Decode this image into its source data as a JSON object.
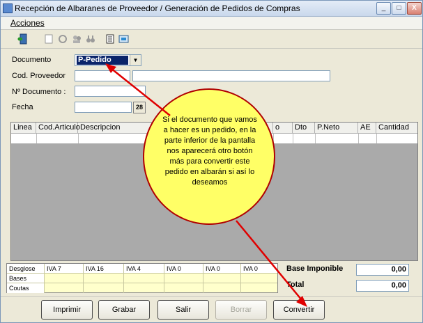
{
  "window": {
    "title": "Recepción de Albaranes de Proveedor / Generación de Pedidos de Compras",
    "controls": [
      "_",
      "□",
      "X"
    ]
  },
  "menu": {
    "acciones": "Acciones"
  },
  "toolbar": {
    "icons": [
      "exit-door-icon",
      "new-document-icon",
      "wizard-icon",
      "users-icon",
      "binoculars-icon",
      "report-icon",
      "print-preview-icon"
    ]
  },
  "form": {
    "documento_label": "Documento",
    "documento_value": "P-Pedido",
    "cod_proveedor_label": "Cod. Proveedor",
    "cod_proveedor_value": "",
    "proveedor_nombre_value": "",
    "num_documento_label": "Nº Documento :",
    "num_documento_value": "",
    "fecha_label": "Fecha",
    "fecha_value": ""
  },
  "grid": {
    "columns": [
      "Linea",
      "Cod.Articulo",
      "Descripcion",
      "o",
      "Dto",
      "P.Neto",
      "AE",
      "Cantidad"
    ]
  },
  "taxes": {
    "row_labels": [
      "Desglose",
      "Bases",
      "Coutas"
    ],
    "columns": [
      "IVA 7",
      "IVA 16",
      "IVA 4",
      "IVA 0",
      "IVA 0",
      "IVA 0"
    ]
  },
  "totals": {
    "base_imponible_label": "Base Imponible",
    "base_imponible_value": "0,00",
    "total_label": "Total",
    "total_value": "0,00"
  },
  "buttons": {
    "imprimir": "Imprimir",
    "grabar": "Grabar",
    "salir": "Salir",
    "borrar": "Borrar",
    "convertir": "Convertir"
  },
  "callout": {
    "text": "Si el documento que vamos a hacer es un pedido, en la parte inferior de la pantalla nos aparecerá otro botón más para convertir este pedido en albarán si así lo deseamos"
  },
  "colors": {
    "callout_fill": "#ffff66",
    "arrow": "#e00000",
    "selected": "#0a246a",
    "tax_fill": "#ffffcc"
  }
}
